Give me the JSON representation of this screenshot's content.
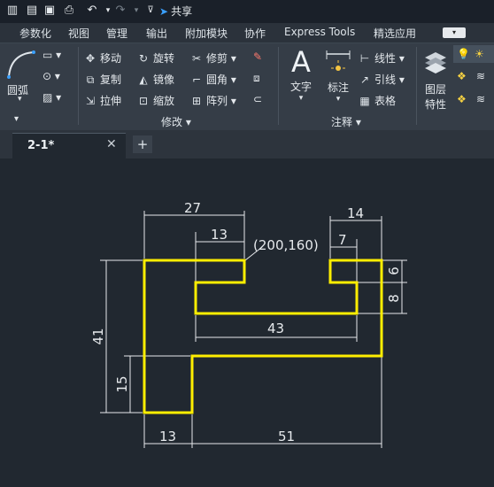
{
  "qat": {
    "share_label": "共享",
    "icons": [
      "open-file-icon",
      "save-icon",
      "save-as-icon",
      "print-icon",
      "undo-icon",
      "redo-icon",
      "share-icon"
    ]
  },
  "menu": {
    "items": [
      "参数化",
      "视图",
      "管理",
      "输出",
      "附加模块",
      "协作",
      "Express Tools",
      "精选应用"
    ]
  },
  "ribbon": {
    "draw": {
      "arc_label": "圆弧"
    },
    "modify": {
      "title": "修改 ▾",
      "move": "移动",
      "rotate": "旋转",
      "trim": "修剪",
      "copy": "复制",
      "mirror": "镜像",
      "fillet": "圆角",
      "stretch": "拉伸",
      "scale": "缩放",
      "array": "阵列"
    },
    "annotation": {
      "title": "注释 ▾",
      "text": "文字",
      "dimension": "标注",
      "linear": "线性",
      "leader": "引线",
      "table": "表格"
    },
    "layers": {
      "line1": "图层",
      "line2": "特性"
    }
  },
  "tabs": {
    "active": "2-1*",
    "close": "✕",
    "new": "+"
  },
  "drawing": {
    "dims": {
      "top_width": "27",
      "notch": "13",
      "right_width": "14",
      "right_notch": "7",
      "right_h1": "6",
      "right_h2": "8",
      "slot_width": "43",
      "total_height": "41",
      "leg_height": "15",
      "leg_width": "13",
      "base_width": "51"
    },
    "point_label": "(200,160)"
  },
  "colors": {
    "outline": "#ffee00",
    "dim": "#e6e9ec",
    "background": "#212830",
    "accent": "#3aa0ff"
  }
}
